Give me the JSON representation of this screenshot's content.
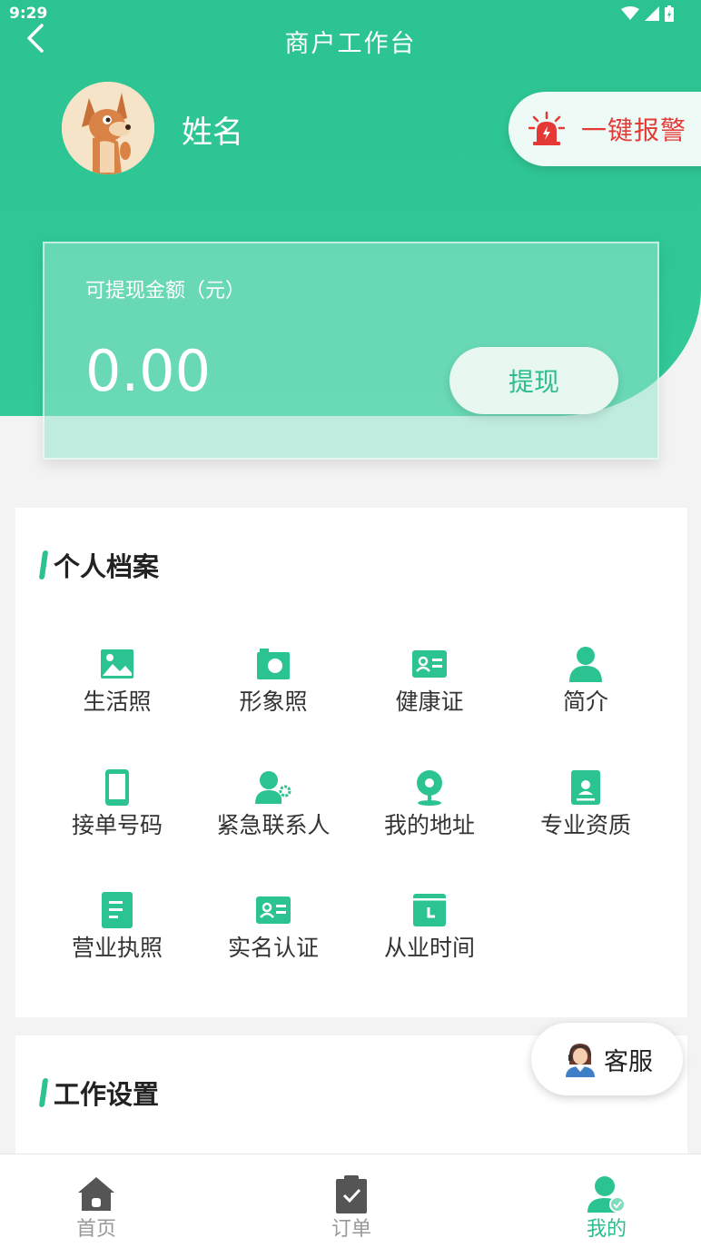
{
  "status_bar": {
    "time": "9:29"
  },
  "header": {
    "title": "商户工作台"
  },
  "user": {
    "name": "姓名"
  },
  "alarm": {
    "label": "一键报警"
  },
  "balance": {
    "label": "可提现金额（元）",
    "amount": "0.00",
    "withdraw_label": "提现"
  },
  "profile": {
    "title": "个人档案",
    "items": [
      {
        "label": "生活照",
        "icon": "image-icon"
      },
      {
        "label": "形象照",
        "icon": "camera-icon"
      },
      {
        "label": "健康证",
        "icon": "id-card-icon"
      },
      {
        "label": "简介",
        "icon": "person-icon"
      },
      {
        "label": "接单号码",
        "icon": "phone-icon"
      },
      {
        "label": "紧急联系人",
        "icon": "contact-settings-icon"
      },
      {
        "label": "我的地址",
        "icon": "location-icon"
      },
      {
        "label": "专业资质",
        "icon": "certificate-icon"
      },
      {
        "label": "营业执照",
        "icon": "document-icon"
      },
      {
        "label": "实名认证",
        "icon": "id-card-icon"
      },
      {
        "label": "从业时间",
        "icon": "calendar-clock-icon"
      }
    ]
  },
  "work": {
    "title": "工作设置"
  },
  "customer_service": {
    "label": "客服"
  },
  "tabs": [
    {
      "label": "首页",
      "icon": "home-icon"
    },
    {
      "label": "订单",
      "icon": "clipboard-icon"
    },
    {
      "label": "我的",
      "icon": "user-check-icon",
      "active": true
    }
  ],
  "colors": {
    "primary": "#2cc392",
    "alarm": "#e53935",
    "text": "#333333",
    "inactive": "#999999"
  }
}
